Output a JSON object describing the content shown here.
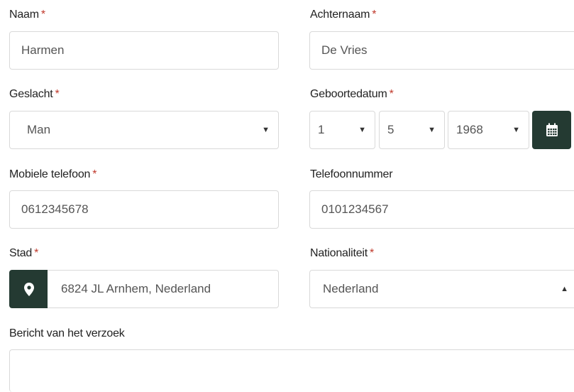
{
  "form": {
    "first_name": {
      "label": "Naam",
      "required_mark": "*",
      "value": "Harmen"
    },
    "last_name": {
      "label": "Achternaam",
      "required_mark": "*",
      "value": "De Vries"
    },
    "gender": {
      "label": "Geslacht",
      "required_mark": "*",
      "value": "Man"
    },
    "birthdate": {
      "label": "Geboortedatum",
      "required_mark": "*",
      "day": "1",
      "month": "5",
      "year": "1968",
      "icon": "calendar-icon"
    },
    "mobile": {
      "label": "Mobiele telefoon",
      "required_mark": "*",
      "value": "0612345678"
    },
    "phone": {
      "label": "Telefoonnummer",
      "value": "0101234567"
    },
    "city": {
      "label": "Stad",
      "required_mark": "*",
      "value": "6824 JL Arnhem, Nederland",
      "icon": "map-marker-icon"
    },
    "nationality": {
      "label": "Nationaliteit",
      "required_mark": "*",
      "value": "Nederland"
    },
    "message": {
      "label": "Bericht van het verzoek",
      "value": ""
    }
  },
  "colors": {
    "accent": "#243a32",
    "required": "#c0392b",
    "border": "#d9d9d9"
  }
}
